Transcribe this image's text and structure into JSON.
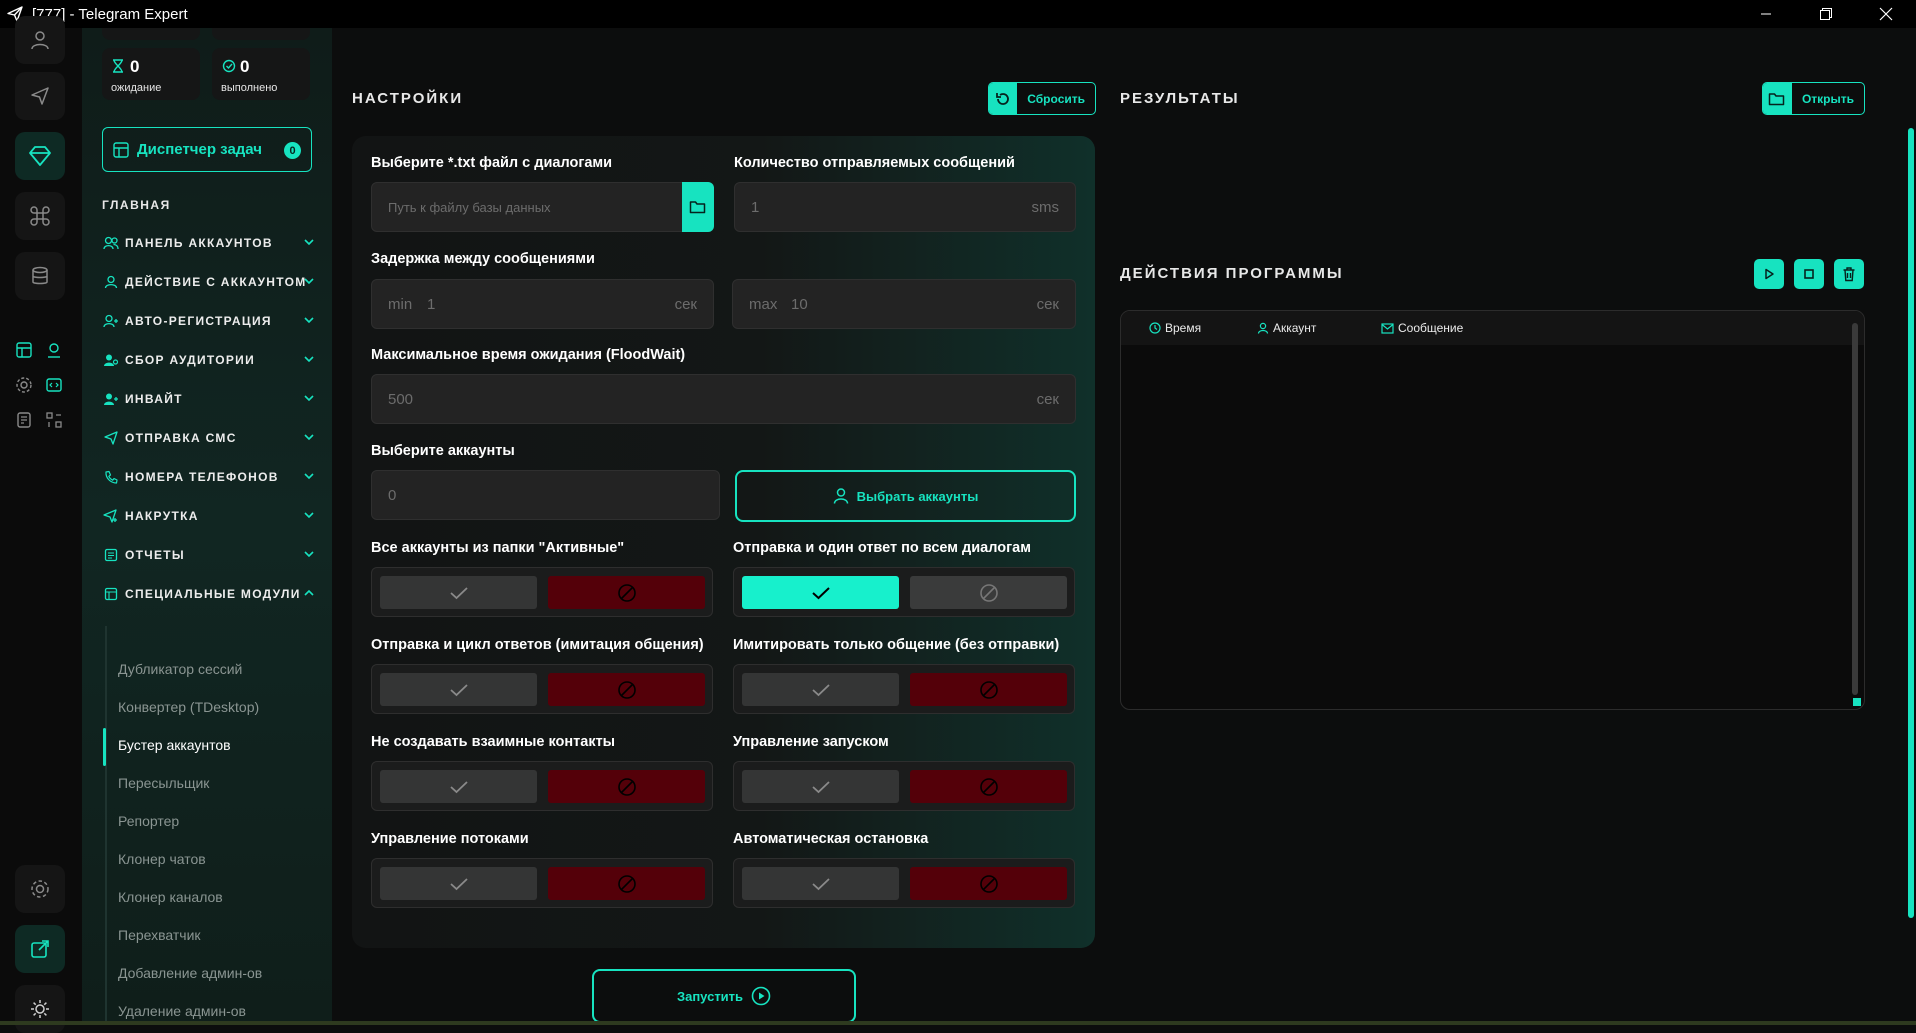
{
  "window": {
    "title": "[777] - Telegram Expert"
  },
  "stats": [
    {
      "value": "0",
      "label": "ожидание",
      "icon": "hourglass-icon"
    },
    {
      "value": "0",
      "label": "выполнено",
      "icon": "check-circle-icon"
    }
  ],
  "dispatcher": {
    "label": "Диспетчер задач",
    "count": "0"
  },
  "sidebar": {
    "section_title": "ГЛАВНАЯ",
    "menu": [
      {
        "label": "ПАНЕЛЬ АККАУНТОВ",
        "icon": "users-icon",
        "expanded": false
      },
      {
        "label": "ДЕЙСТВИЕ С АККАУНТОМ",
        "icon": "user-icon",
        "expanded": false
      },
      {
        "label": "АВТО-РЕГИСТРАЦИЯ",
        "icon": "user-plus-icon",
        "expanded": false
      },
      {
        "label": "СБОР АУДИТОРИИ",
        "icon": "user-search-icon",
        "expanded": false
      },
      {
        "label": "ИНВАЙТ",
        "icon": "user-add-icon",
        "expanded": false
      },
      {
        "label": "ОТПРАВКА СМС",
        "icon": "send-icon",
        "expanded": false
      },
      {
        "label": "НОМЕРА ТЕЛЕФОНОВ",
        "icon": "phone-icon",
        "expanded": false
      },
      {
        "label": "НАКРУТКА",
        "icon": "boost-icon",
        "expanded": false
      },
      {
        "label": "ОТЧЕТЫ",
        "icon": "report-icon",
        "expanded": false
      },
      {
        "label": "СПЕЦИАЛЬНЫЕ МОДУЛИ",
        "icon": "modules-icon",
        "expanded": true
      }
    ],
    "submenu": [
      {
        "label": "Дубликатор сессий",
        "active": false
      },
      {
        "label": "Конвертер (TDesktop)",
        "active": false
      },
      {
        "label": "Бустер аккаунтов",
        "active": true
      },
      {
        "label": "Пересыльщик",
        "active": false
      },
      {
        "label": "Репортер",
        "active": false
      },
      {
        "label": "Клонер чатов",
        "active": false
      },
      {
        "label": "Клонер каналов",
        "active": false
      },
      {
        "label": "Перехватчик",
        "active": false
      },
      {
        "label": "Добавление админ-ов",
        "active": false
      },
      {
        "label": "Удаление админ-ов",
        "active": false
      }
    ]
  },
  "settings": {
    "title": "НАСТРОЙКИ",
    "reset_label": "Сбросить",
    "file_label": "Выберите *.txt файл с диалогами",
    "file_placeholder": "Путь к файлу базы данных",
    "count_label": "Количество отправляемых сообщений",
    "count_value": "1",
    "count_unit": "sms",
    "delay_label": "Задержка между сообщениями",
    "delay_min_prefix": "min",
    "delay_min_value": "1",
    "delay_max_prefix": "max",
    "delay_max_value": "10",
    "delay_unit": "сек",
    "floodwait_label": "Максимальное время ожидания (FloodWait)",
    "floodwait_value": "500",
    "floodwait_unit": "сек",
    "accounts_label": "Выберите аккаунты",
    "accounts_value": "0",
    "select_accounts_label": "Выбрать аккаунты",
    "toggles": [
      {
        "label": "Все аккаунты из папки \"Активные\"",
        "on": false
      },
      {
        "label": "Отправка и один ответ по всем диалогам",
        "on": true
      },
      {
        "label": "Отправка и цикл ответов (имитация общения)",
        "on": false
      },
      {
        "label": "Имитировать только общение (без отправки)",
        "on": false
      },
      {
        "label": "Не создавать взаимные контакты",
        "on": false
      },
      {
        "label": "Управление запуском",
        "on": false
      },
      {
        "label": "Управление потоками",
        "on": false
      },
      {
        "label": "Автоматическая остановка",
        "on": false
      }
    ]
  },
  "run": {
    "label": "Запустить"
  },
  "results": {
    "title": "РЕЗУЛЬТАТЫ",
    "open_label": "Открыть"
  },
  "actions": {
    "title": "ДЕЙСТВИЯ ПРОГРАММЫ",
    "columns": [
      "Время",
      "Аккаунт",
      "Сообщение"
    ]
  },
  "colors": {
    "accent": "#17e3c0",
    "danger": "#540009",
    "background": "#0c0d0d"
  }
}
